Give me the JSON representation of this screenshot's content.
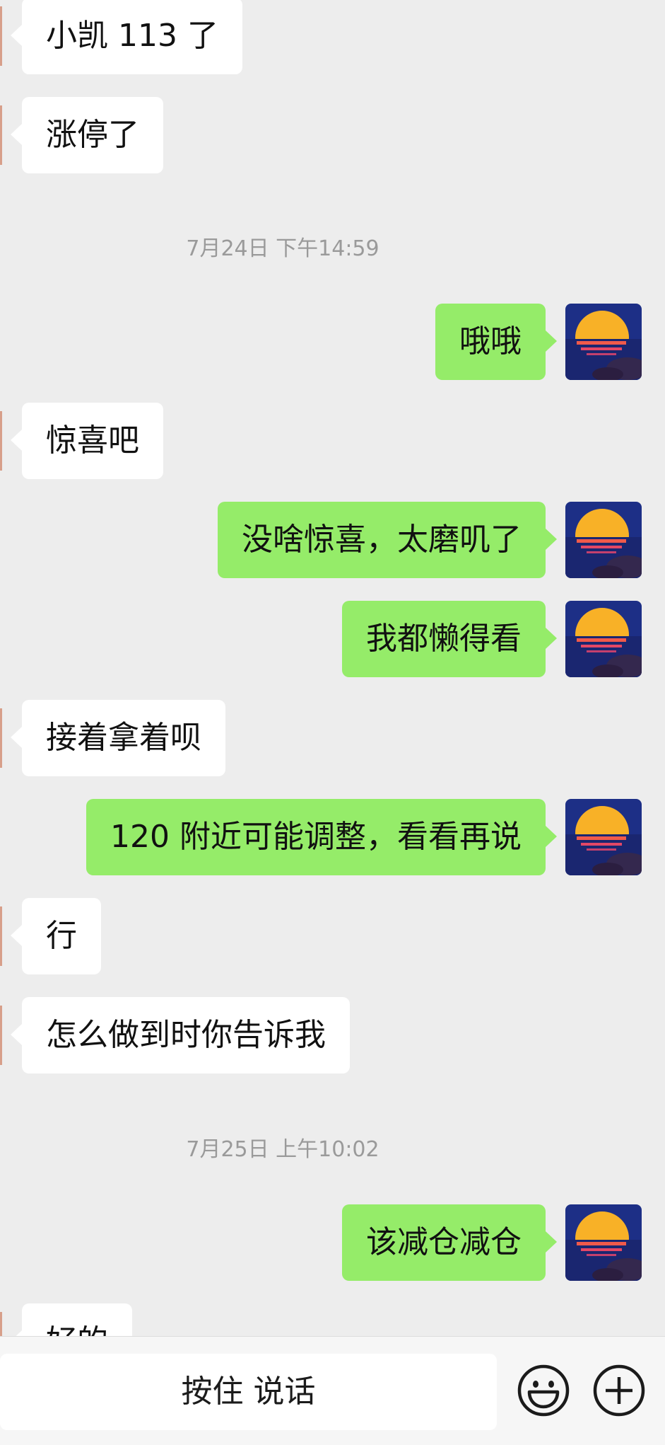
{
  "messages": [
    {
      "type": "in",
      "text": "小凯 113 了"
    },
    {
      "type": "in",
      "text": "涨停了"
    },
    {
      "type": "time",
      "text": "7月24日 下午14:59"
    },
    {
      "type": "out",
      "text": "哦哦"
    },
    {
      "type": "in",
      "text": "惊喜吧"
    },
    {
      "type": "out",
      "text": "没啥惊喜，太磨叽了"
    },
    {
      "type": "out",
      "text": "我都懒得看"
    },
    {
      "type": "in",
      "text": "接着拿着呗"
    },
    {
      "type": "out",
      "text": "120 附近可能调整，看看再说"
    },
    {
      "type": "in",
      "text": "行"
    },
    {
      "type": "in",
      "text": "怎么做到时你告诉我"
    },
    {
      "type": "time",
      "text": "7月25日 上午10:02"
    },
    {
      "type": "out",
      "text": "该减仓减仓"
    },
    {
      "type": "in",
      "text": "好的"
    }
  ],
  "input_bar": {
    "hold_to_talk": "按住 说话"
  },
  "icons": {
    "emoji": "emoji-icon",
    "plus": "plus-icon"
  },
  "colors": {
    "background": "#ededed",
    "bubble_in": "#ffffff",
    "bubble_out": "#95ec69",
    "timestamp": "#9a9a9a"
  }
}
